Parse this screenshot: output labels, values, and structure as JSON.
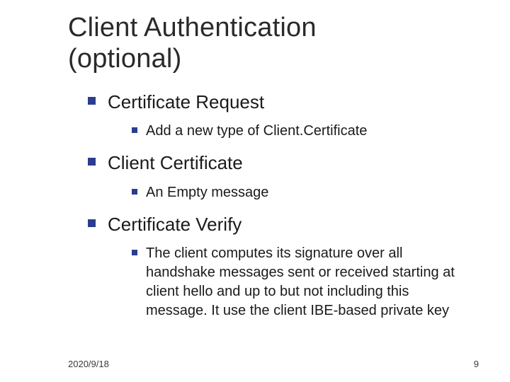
{
  "title_line1": "Client Authentication",
  "title_line2": "(optional)",
  "items": [
    {
      "label": "Certificate Request",
      "sub": [
        {
          "text": "Add a new type of Client.Certificate"
        }
      ]
    },
    {
      "label": "Client Certificate",
      "sub": [
        {
          "text": "An Empty message"
        }
      ]
    },
    {
      "label": "Certificate Verify",
      "sub": [
        {
          "text": "The client computes its signature over all handshake messages sent or received starting at client hello and up to but not including this message. It use the client IBE-based private key"
        }
      ]
    }
  ],
  "footer": {
    "date": "2020/9/18",
    "page": "9"
  },
  "colors": {
    "bullet": "#2b3d8f"
  }
}
